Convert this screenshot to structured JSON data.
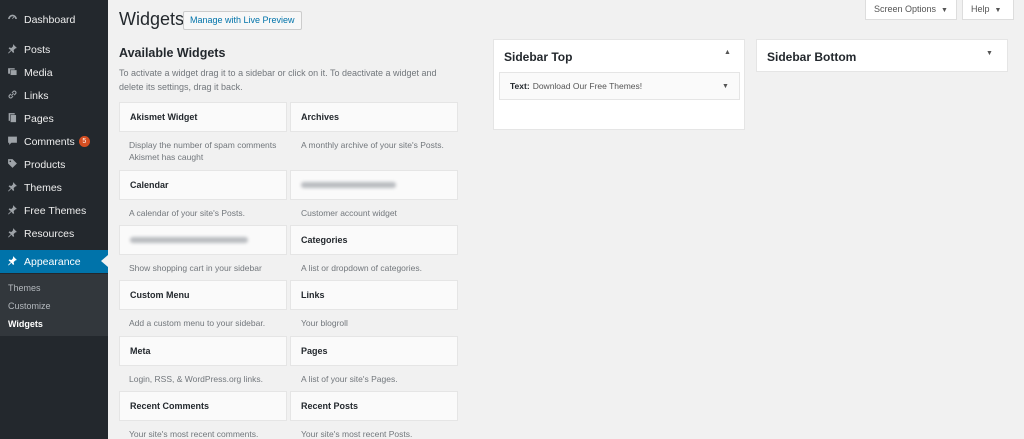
{
  "sidebar": {
    "items": [
      {
        "label": "Dashboard",
        "icon": "dashboard-icon"
      },
      {
        "label": "Posts",
        "icon": "pin-icon"
      },
      {
        "label": "Media",
        "icon": "media-icon"
      },
      {
        "label": "Links",
        "icon": "link-icon"
      },
      {
        "label": "Pages",
        "icon": "pages-icon"
      },
      {
        "label": "Comments",
        "icon": "comment-icon",
        "badge": "5"
      },
      {
        "label": "Products",
        "icon": "tag-icon"
      },
      {
        "label": "Themes",
        "icon": "pin-icon"
      },
      {
        "label": "Free Themes",
        "icon": "pin-icon"
      },
      {
        "label": "Resources",
        "icon": "pin-icon"
      },
      {
        "label": "Appearance",
        "icon": "brush-icon"
      }
    ],
    "submenu": [
      {
        "label": "Themes"
      },
      {
        "label": "Customize"
      },
      {
        "label": "Widgets"
      }
    ]
  },
  "header": {
    "title": "Widgets",
    "live_preview_label": "Manage with Live Preview",
    "screen_options_label": "Screen Options",
    "help_label": "Help"
  },
  "available": {
    "title": "Available Widgets",
    "description": "To activate a widget drag it to a sidebar or click on it. To deactivate a widget and delete its settings, drag it back.",
    "widgets": [
      {
        "title": "Akismet Widget",
        "desc": "Display the number of spam comments Akismet has caught"
      },
      {
        "title": "Archives",
        "desc": "A monthly archive of your site's Posts."
      },
      {
        "title": "Calendar",
        "desc": "A calendar of your site's Posts."
      },
      {
        "title": "",
        "desc": "Customer account widget"
      },
      {
        "title": "",
        "desc": "Show shopping cart in your sidebar"
      },
      {
        "title": "Categories",
        "desc": "A list or dropdown of categories."
      },
      {
        "title": "Custom Menu",
        "desc": "Add a custom menu to your sidebar."
      },
      {
        "title": "Links",
        "desc": "Your blogroll"
      },
      {
        "title": "Meta",
        "desc": "Login, RSS, & WordPress.org links."
      },
      {
        "title": "Pages",
        "desc": "A list of your site's Pages."
      },
      {
        "title": "Recent Comments",
        "desc": "Your site's most recent comments."
      },
      {
        "title": "Recent Posts",
        "desc": "Your site's most recent Posts."
      }
    ]
  },
  "sidebars": {
    "top": {
      "title": "Sidebar Top",
      "widget_type": "Text:",
      "widget_title": "Download Our Free Themes!"
    },
    "bottom": {
      "title": "Sidebar Bottom"
    }
  },
  "colors": {
    "menu_bg": "#23282d",
    "submenu_bg": "#32373c",
    "accent": "#0073aa",
    "badge": "#d54e21",
    "page_bg": "#f1f1f1"
  }
}
